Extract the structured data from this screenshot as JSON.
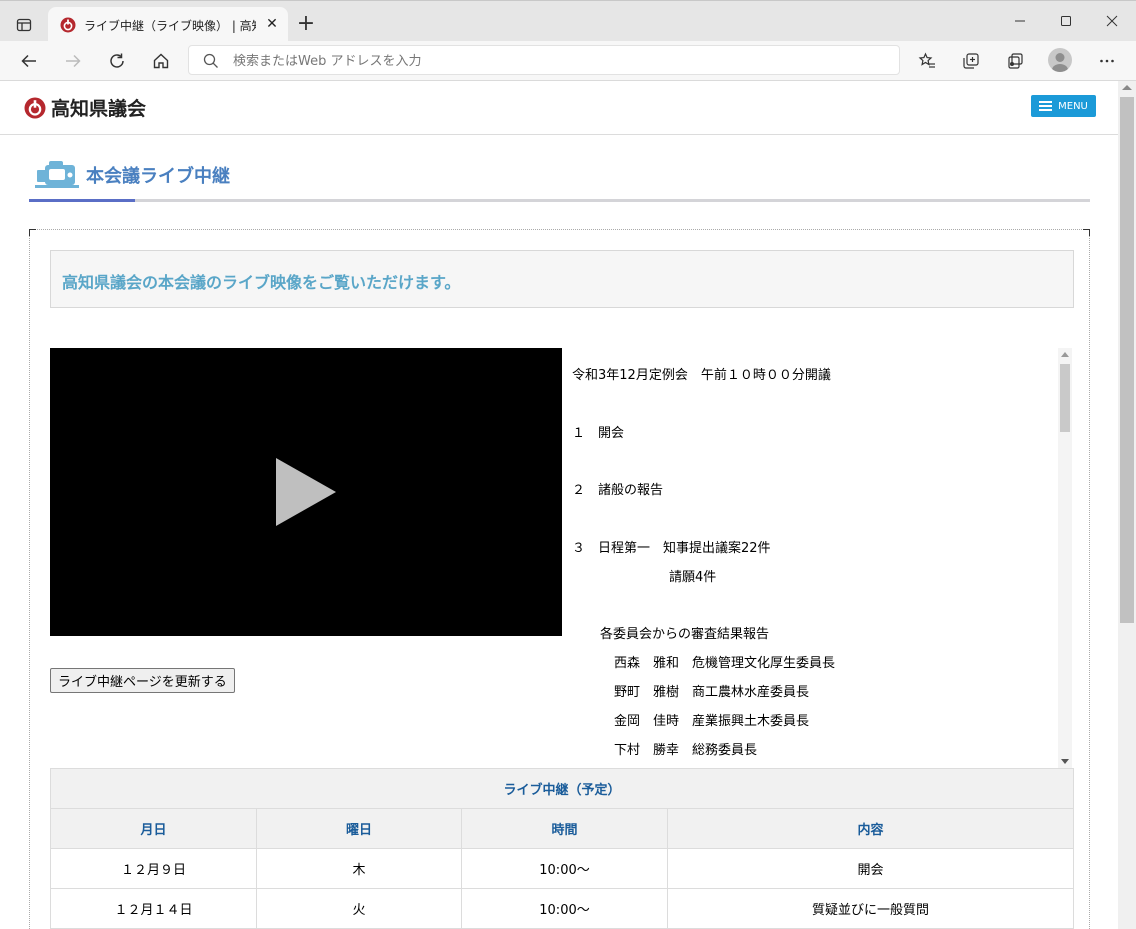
{
  "browser": {
    "tab_title": "ライブ中継（ライブ映像） | 高知県議会",
    "address_placeholder": "検索またはWeb アドレスを入力"
  },
  "site": {
    "logo_text": "高知県議会",
    "menu_label": "MENU",
    "brand_color": "#1b9ad8"
  },
  "page": {
    "heading": "本会議ライブ中継",
    "intro": "高知県議会の本会議のライブ映像をご覧いただけます。",
    "refresh_button": "ライブ中継ページを更新する"
  },
  "agenda": [
    "令和3年12月定例会　午前１０時００分開議",
    "１　開会",
    "２　諸般の報告",
    "３　日程第一　知事提出議案22件",
    "請願4件",
    "各委員会からの審査結果報告",
    "西森　雅和　危機管理文化厚生委員長",
    "野町　雅樹　商工農林水産委員長",
    "金岡　佳時　産業振興土木委員長",
    "下村　勝幸　総務委員長"
  ],
  "schedule": {
    "caption": "ライブ中継（予定）",
    "headers": [
      "月日",
      "曜日",
      "時間",
      "内容"
    ],
    "rows": [
      [
        "１２月９日",
        "木",
        "10:00～",
        "開会"
      ],
      [
        "１２月１４日",
        "火",
        "10:00～",
        "質疑並びに一般質問"
      ]
    ]
  }
}
